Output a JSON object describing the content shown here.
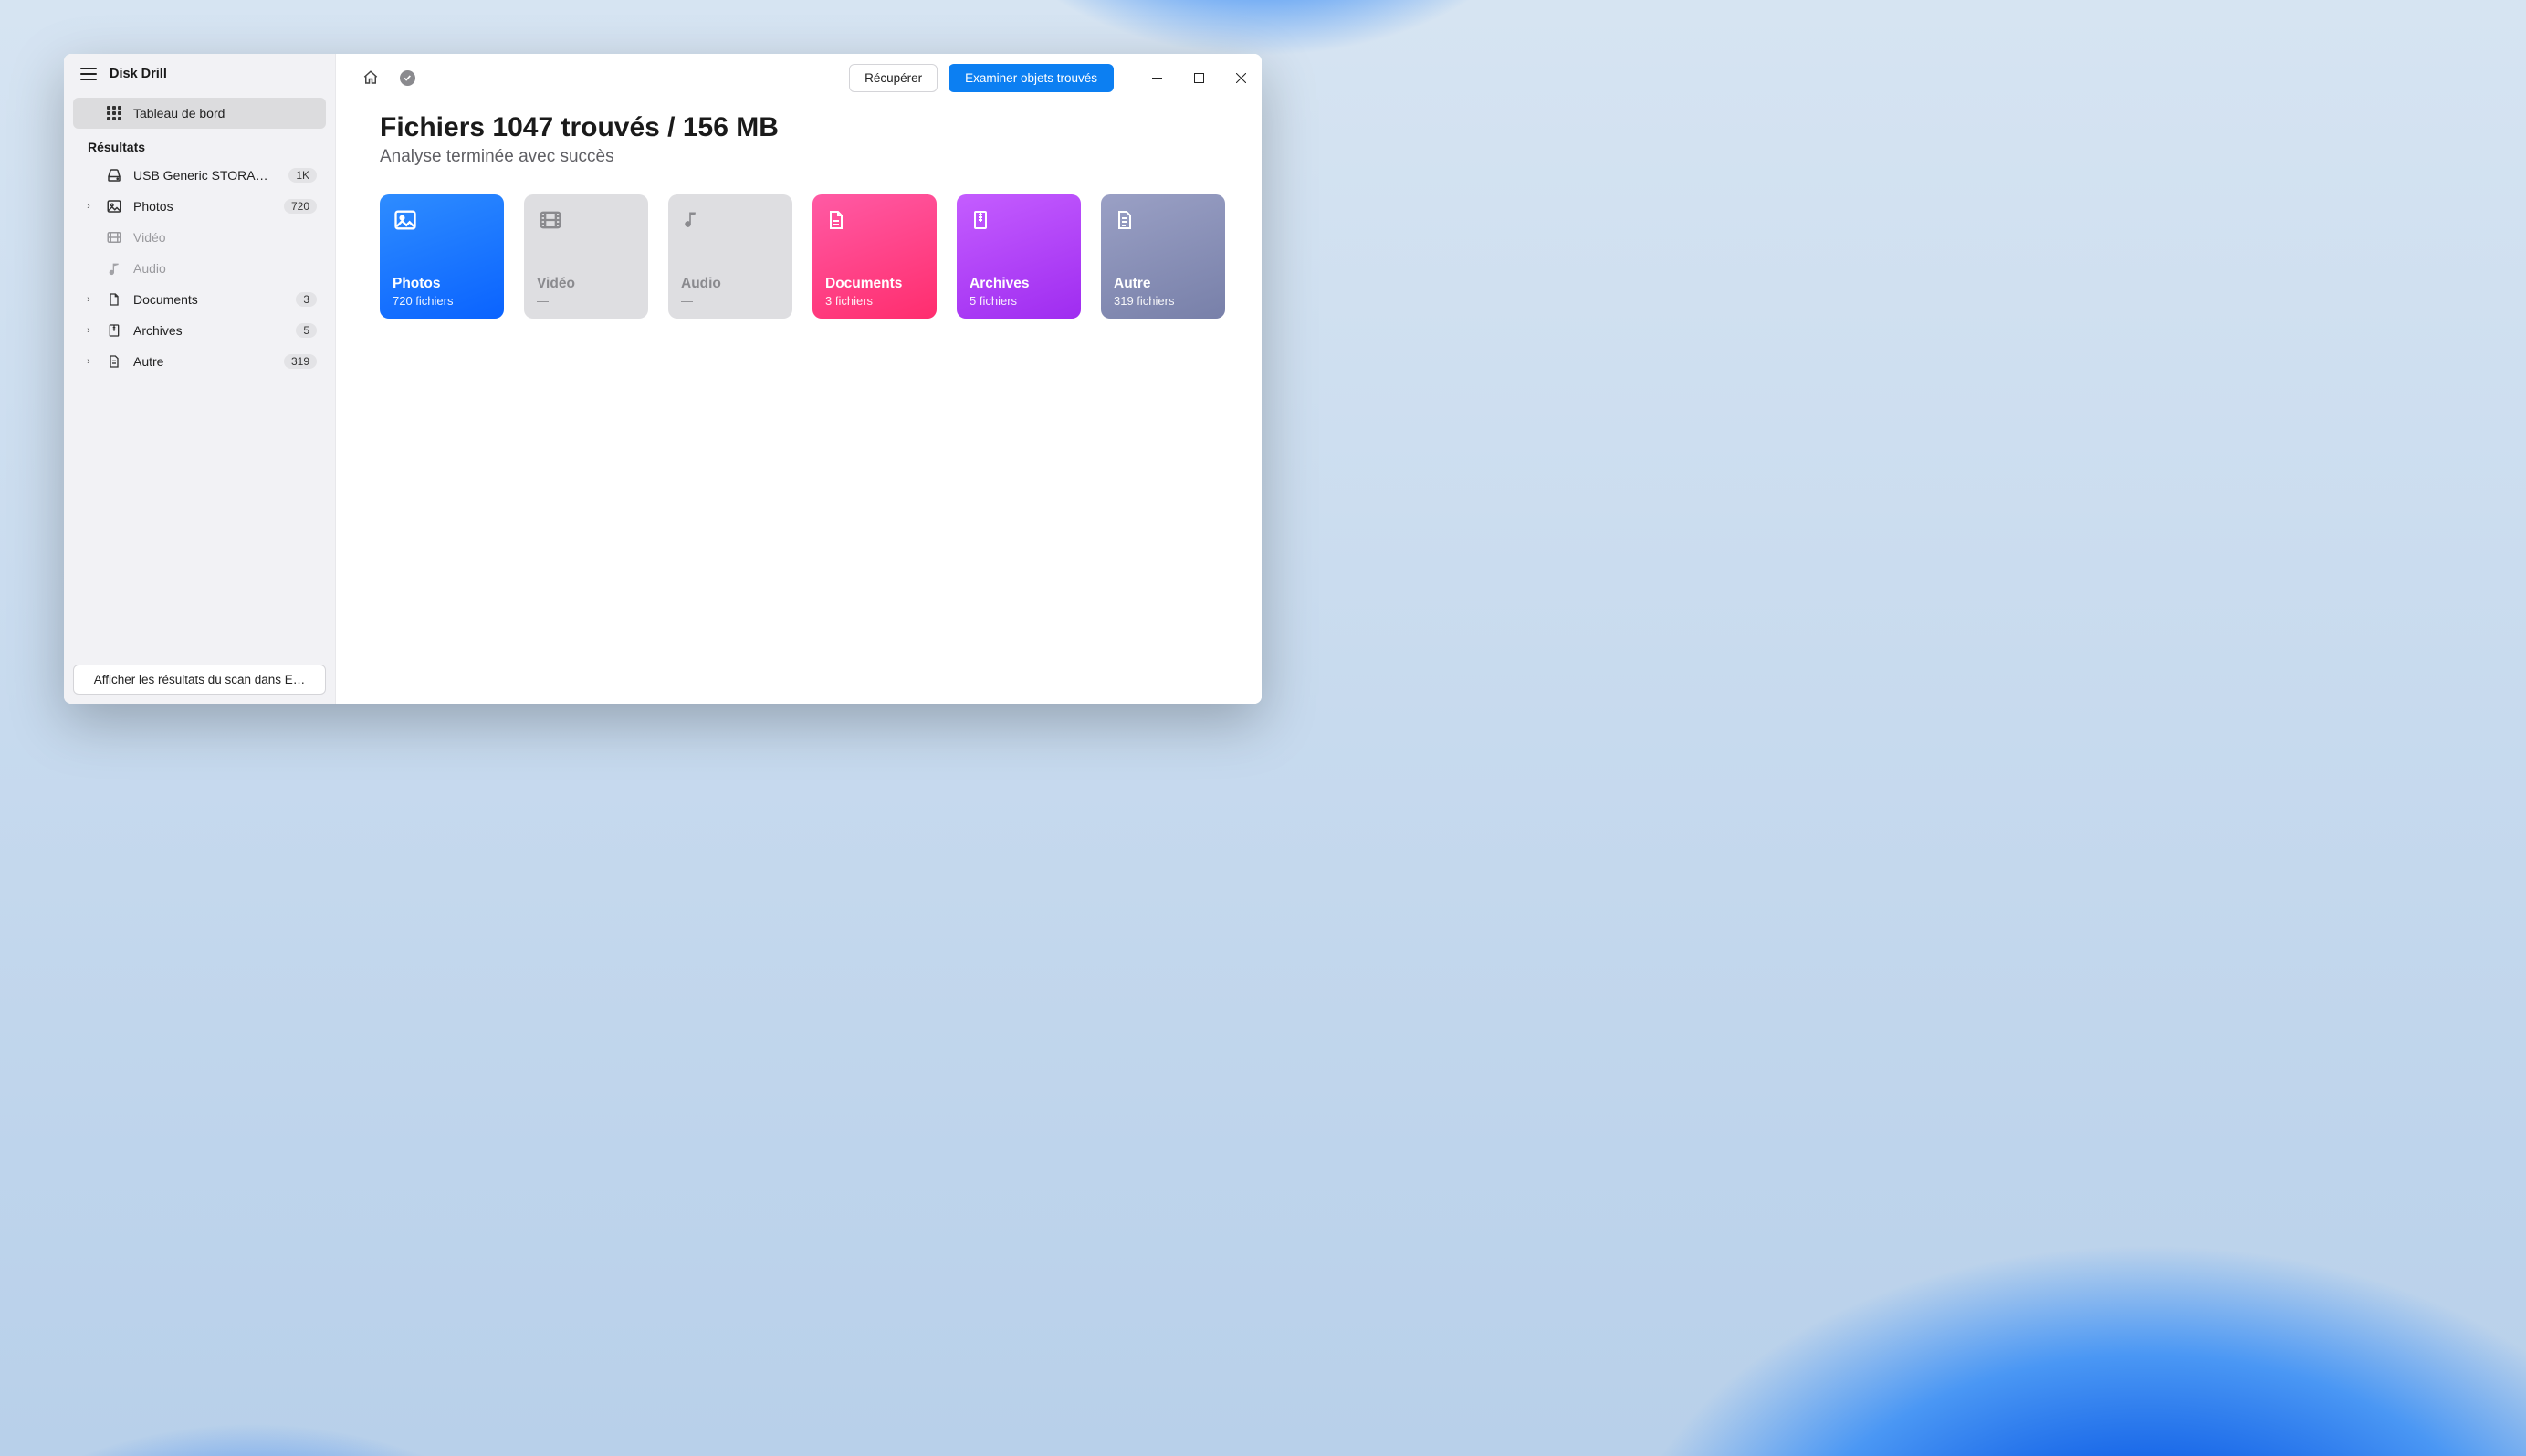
{
  "app": {
    "title": "Disk Drill"
  },
  "sidebar": {
    "dashboard_label": "Tableau de bord",
    "results_label": "Résultats",
    "device": {
      "label": "USB Generic STORAGE D…",
      "badge": "1K"
    },
    "items": [
      {
        "key": "photos",
        "label": "Photos",
        "badge": "720",
        "expandable": true,
        "disabled": false
      },
      {
        "key": "video",
        "label": "Vidéo",
        "badge": "",
        "expandable": false,
        "disabled": true
      },
      {
        "key": "audio",
        "label": "Audio",
        "badge": "",
        "expandable": false,
        "disabled": true
      },
      {
        "key": "documents",
        "label": "Documents",
        "badge": "3",
        "expandable": true,
        "disabled": false
      },
      {
        "key": "archives",
        "label": "Archives",
        "badge": "5",
        "expandable": true,
        "disabled": false
      },
      {
        "key": "other",
        "label": "Autre",
        "badge": "319",
        "expandable": true,
        "disabled": false
      }
    ],
    "explorer_btn": "Afficher les résultats du scan dans E…"
  },
  "toolbar": {
    "recover_label": "Récupérer",
    "examine_label": "Examiner objets trouvés"
  },
  "summary": {
    "headline": "Fichiers 1047 trouvés / 156 MB",
    "subhead": "Analyse terminée avec succès"
  },
  "cards": [
    {
      "key": "photos",
      "title": "Photos",
      "sub": "720 fichiers",
      "variant": "photos"
    },
    {
      "key": "video",
      "title": "Vidéo",
      "sub": "—",
      "variant": "disabled"
    },
    {
      "key": "audio",
      "title": "Audio",
      "sub": "—",
      "variant": "disabled"
    },
    {
      "key": "documents",
      "title": "Documents",
      "sub": "3 fichiers",
      "variant": "docs"
    },
    {
      "key": "archives",
      "title": "Archives",
      "sub": "5 fichiers",
      "variant": "arch"
    },
    {
      "key": "other",
      "title": "Autre",
      "sub": "319 fichiers",
      "variant": "other"
    }
  ]
}
